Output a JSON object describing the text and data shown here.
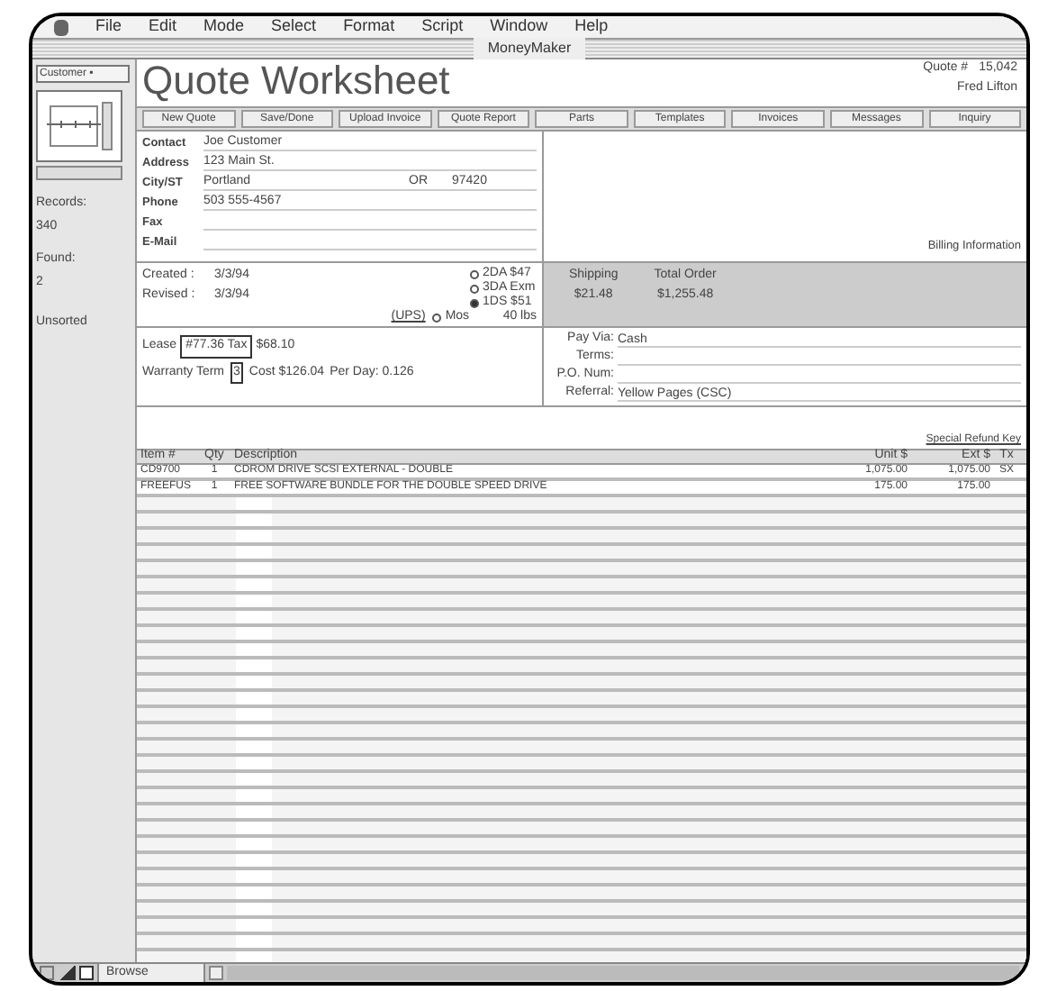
{
  "menu_bar": {
    "items": [
      "File",
      "Edit",
      "Mode",
      "Select",
      "Format",
      "Script",
      "Window",
      "Help"
    ]
  },
  "window": {
    "title": "MoneyMaker"
  },
  "sidebar": {
    "layout_button": "Customer ▪",
    "records_label": "Records:",
    "records": "340",
    "found_label": "Found:",
    "found": "2",
    "sort": "Unsorted"
  },
  "header": {
    "title": "Quote Worksheet",
    "quote_label": "Quote #",
    "quote_number": "15,042",
    "salesperson": "Fred Lifton"
  },
  "toolbar": [
    "New Quote",
    "Save/Done",
    "Upload Invoice",
    "Quote Report",
    "Parts",
    "Templates",
    "Invoices",
    "Messages",
    "Inquiry"
  ],
  "contact": [
    {
      "label": "Contact",
      "value": "Joe Customer"
    },
    {
      "label": "Address",
      "value": "123 Main St."
    },
    {
      "label": "City/ST",
      "value": "Portland",
      "state": "OR",
      "zip": "97420"
    },
    {
      "label": "Phone",
      "value": "503 555-4567"
    },
    {
      "label": "Fax"
    },
    {
      "label": "E-Mail"
    }
  ],
  "billing": {
    "label": "Billing Information"
  },
  "dates": [
    {
      "label": "Created :",
      "value": "3/3/94"
    },
    {
      "label": "Revised :",
      "value": "3/3/94"
    }
  ],
  "shipping_options": [
    {
      "label": "2DA $47",
      "selected": false
    },
    {
      "label": "3DA Exm",
      "selected": false
    },
    {
      "label": "1DS $51",
      "selected": true
    },
    {
      "label": "Mos",
      "selected": false
    }
  ],
  "shipping_note": "(UPS)",
  "weight": "40 lbs",
  "totals": [
    {
      "label": "Shipping",
      "value": "$21.48"
    },
    {
      "label": "Total Order",
      "value": "$1,255.48"
    }
  ],
  "payment": [
    {
      "label": "Pay Via:",
      "value": "Cash"
    },
    {
      "label": "Terms:"
    },
    {
      "label": "P.O. Num:"
    },
    {
      "label": "Referral:",
      "value": "Yellow Pages (CSC)"
    }
  ],
  "lease": {
    "label": "Lease",
    "option": "#77.36 Tax",
    "amount": "$68.10"
  },
  "warranty": {
    "label": "Warranty Term",
    "term": "3",
    "cost": "Cost $126.04",
    "per_day": "Per Day: 0.126"
  },
  "table": {
    "note": "Special Refund Key",
    "columns": [
      "Item #",
      "Qty",
      "Description",
      "Unit $",
      "Ext $",
      "Tx"
    ],
    "rows": [
      [
        "CD9700",
        "1",
        "CDROM DRIVE SCSI EXTERNAL - DOUBLE",
        "1,075.00",
        "1,075.00",
        "SX"
      ],
      [
        "FREEFUS",
        "1",
        "FREE SOFTWARE BUNDLE FOR THE DOUBLE SPEED DRIVE",
        "175.00",
        "175.00",
        null
      ]
    ]
  },
  "status_bar": {
    "mode": "Browse"
  }
}
